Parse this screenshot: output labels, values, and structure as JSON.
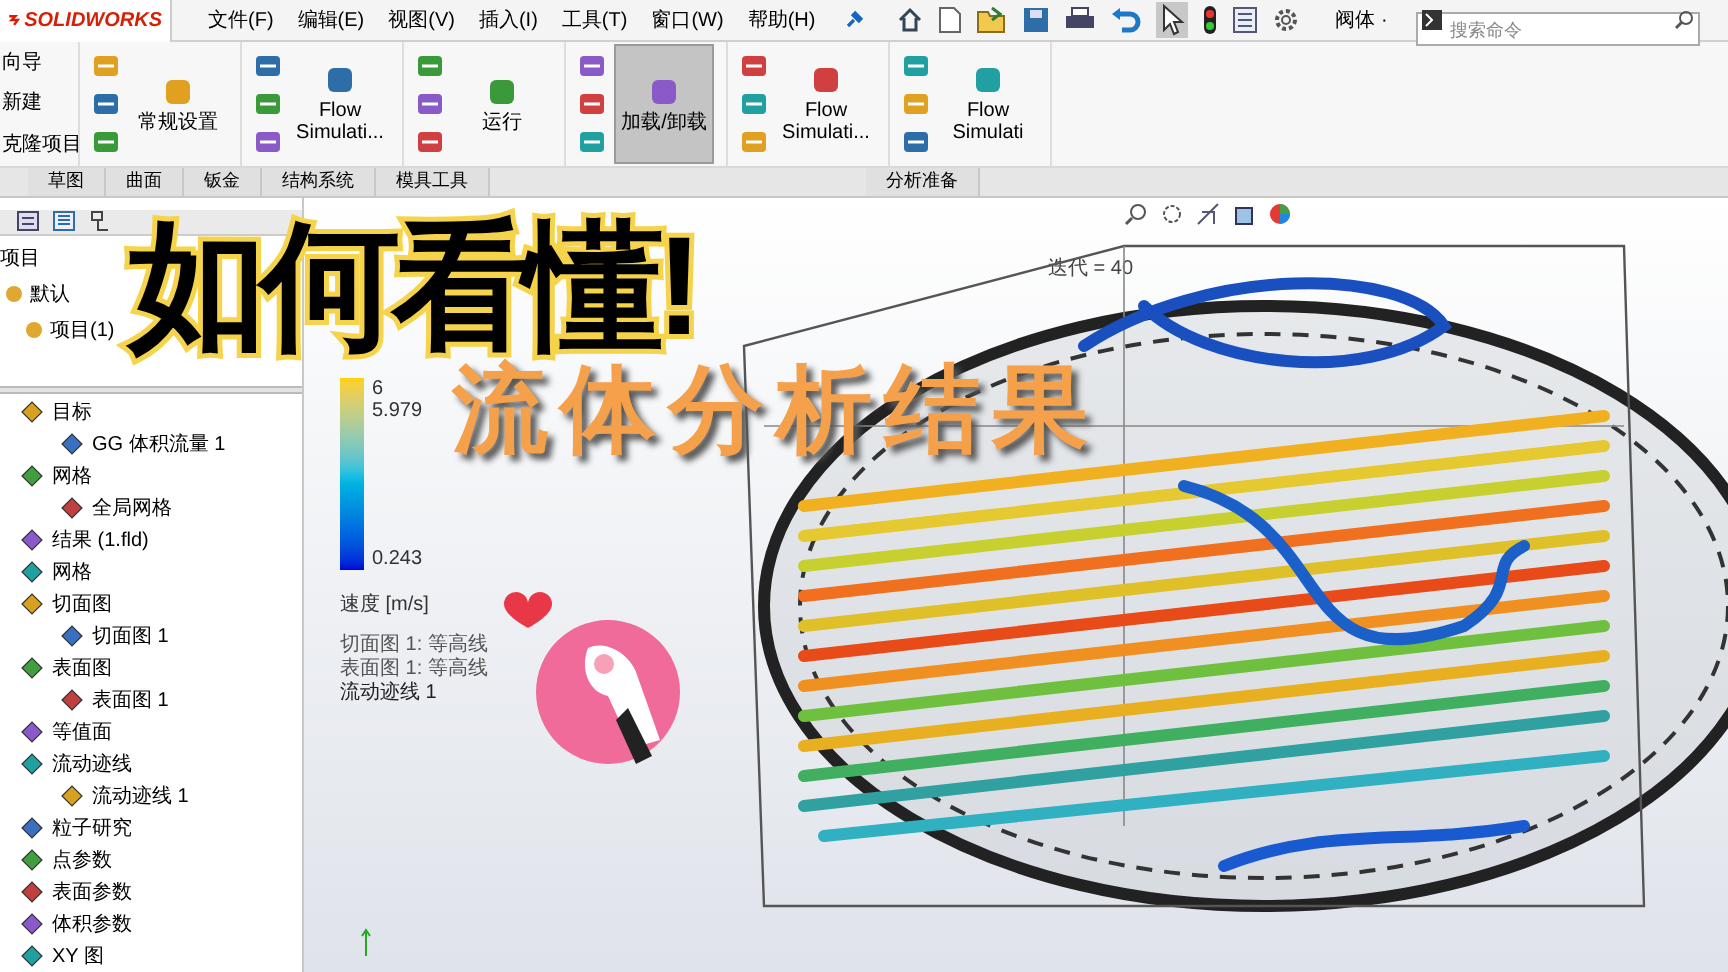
{
  "app": {
    "logo": "SOLIDWORKS"
  },
  "menu": [
    "文件(F)",
    "编辑(E)",
    "视图(V)",
    "插入(I)",
    "工具(T)",
    "窗口(W)",
    "帮助(H)"
  ],
  "quick_access": {
    "material": "阀体 ·",
    "search": {
      "placeholder": "搜索命令"
    }
  },
  "ribbon": {
    "stack": [
      "向导",
      "新建",
      "克隆项目"
    ],
    "commands": [
      {
        "label": "常规设置",
        "selected": false
      },
      {
        "label": "Flow Simulati...",
        "selected": false
      },
      {
        "label": "运行",
        "selected": false
      },
      {
        "label": "加载/卸载",
        "selected": true
      },
      {
        "label": "Flow Simulati...",
        "selected": false
      },
      {
        "label": "Flow Simulati",
        "selected": false
      }
    ]
  },
  "tabs": [
    {
      "label": "草图",
      "selected": false
    },
    {
      "label": "曲面",
      "selected": false
    },
    {
      "label": "钣金",
      "selected": false
    },
    {
      "label": "结构系统",
      "selected": false
    },
    {
      "label": "模具工具",
      "selected": false
    },
    {
      "label": "分析准备",
      "selected": false
    }
  ],
  "config_tree": [
    {
      "label": "项目"
    },
    {
      "label": "默认"
    },
    {
      "label": "项目(1)"
    }
  ],
  "study_tree": [
    {
      "label": "目标",
      "children": [
        {
          "label": "GG 体积流量 1"
        }
      ]
    },
    {
      "label": "网格",
      "children": [
        {
          "label": "全局网格"
        }
      ]
    },
    {
      "label": "结果 (1.fld)"
    },
    {
      "label": "网格"
    },
    {
      "label": "切面图",
      "children": [
        {
          "label": "切面图 1"
        }
      ]
    },
    {
      "label": "表面图",
      "children": [
        {
          "label": "表面图 1"
        }
      ]
    },
    {
      "label": "等值面"
    },
    {
      "label": "流动迹线",
      "children": [
        {
          "label": "流动迹线 1"
        }
      ]
    },
    {
      "label": "粒子研究"
    },
    {
      "label": "点参数"
    },
    {
      "label": "表面参数"
    },
    {
      "label": "体积参数"
    },
    {
      "label": "XY 图"
    }
  ],
  "viewport": {
    "iteration": "迭代 = 40",
    "legend": {
      "values": [
        "6",
        "5.979",
        "0.243"
      ],
      "quantity": "速度 [m/s]"
    },
    "plots": [
      "切面图 1: 等高线",
      "表面图 1: 等高线",
      "流动迹线 1"
    ]
  },
  "overlay": {
    "title": "如何看懂!",
    "subtitle": "流体分析结果"
  }
}
